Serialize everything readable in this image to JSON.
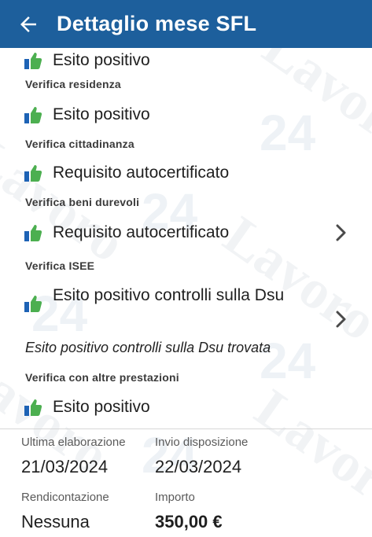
{
  "header": {
    "title": "Dettaglio mese SFL",
    "back_icon": "arrow-left-icon"
  },
  "checks": [
    {
      "label": "",
      "result": "Esito positivo",
      "has_chevron": false
    },
    {
      "label": "Verifica residenza",
      "result": "Esito positivo",
      "has_chevron": false
    },
    {
      "label": "Verifica cittadinanza",
      "result": "Requisito autocertificato",
      "has_chevron": false
    },
    {
      "label": "Verifica beni durevoli",
      "result": "Requisito autocertificato",
      "has_chevron": true
    },
    {
      "label": "Verifica ISEE",
      "result": "Esito positivo controlli sulla Dsu",
      "note": "Esito positivo controlli sulla Dsu trovata",
      "has_chevron": true
    },
    {
      "label": "Verifica con altre prestazioni",
      "result": "Esito positivo",
      "has_chevron": false
    }
  ],
  "summary": {
    "ultima_elaborazione_label": "Ultima elaborazione",
    "ultima_elaborazione_value": "21/03/2024",
    "invio_disposizione_label": "Invio disposizione",
    "invio_disposizione_value": "22/03/2024",
    "rendicontazione_label": "Rendicontazione",
    "rendicontazione_value": "Nessuna",
    "importo_label": "Importo",
    "importo_value": "350,00 €"
  },
  "colors": {
    "appbar": "#1d5f9c",
    "thumb_green": "#4caf50",
    "thumb_blue": "#1e63b5"
  },
  "watermark": {
    "text": "Lavoro 24"
  }
}
